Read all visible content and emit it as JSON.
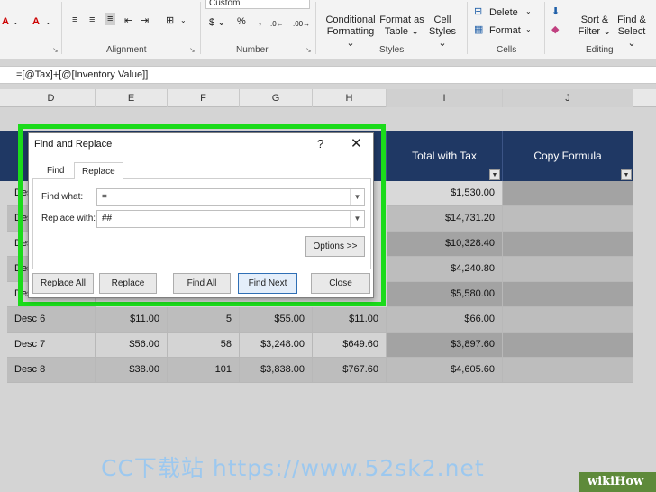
{
  "ribbon": {
    "number_format": "Custom",
    "groups": {
      "alignment": "Alignment",
      "number": "Number",
      "styles": "Styles",
      "cells": "Cells",
      "editing": "Editing"
    },
    "buttons": {
      "conditional_formatting": "Conditional\nFormatting ⌄",
      "format_as_table": "Format as\nTable ⌄",
      "cell_styles": "Cell\nStyles ⌄",
      "delete": "Delete",
      "format": "Format",
      "sort_filter": "Sort &\nFilter ⌄",
      "find_select": "Find &\nSelect ⌄"
    }
  },
  "formula_bar": {
    "formula": "=[@Tax]+[@[Inventory Value]]"
  },
  "columns": [
    "D",
    "E",
    "F",
    "G",
    "H",
    "I",
    "J"
  ],
  "table": {
    "headers": {
      "total_with_tax": "Total with Tax",
      "copy_formula": "Copy Formula"
    },
    "rows_partial": [
      {
        "d": "Desc",
        "i": "$1,530.00"
      },
      {
        "d": "Desc",
        "i": "$14,731.20"
      },
      {
        "d": "Desc",
        "i": "$10,328.40"
      },
      {
        "d": "Desc",
        "i": "$4,240.80"
      },
      {
        "d": "Desc",
        "i": "$5,580.00"
      }
    ],
    "rows": [
      {
        "d": "Desc 6",
        "e": "$11.00",
        "f": "5",
        "g": "$55.00",
        "h": "$11.00",
        "i": "$66.00"
      },
      {
        "d": "Desc 7",
        "e": "$56.00",
        "f": "58",
        "g": "$3,248.00",
        "h": "$649.60",
        "i": "$3,897.60"
      },
      {
        "d": "Desc 8",
        "e": "$38.00",
        "f": "101",
        "g": "$3,838.00",
        "h": "$767.60",
        "i": "$4,605.60"
      }
    ]
  },
  "dialog": {
    "title": "Find and Replace",
    "help": "?",
    "close": "✕",
    "tabs": [
      "Find",
      "Replace"
    ],
    "find_label": "Find what:",
    "find_value": "=",
    "replace_label": "Replace with:",
    "replace_value": "##",
    "options": "Options >>",
    "buttons": [
      "Replace All",
      "Replace",
      "Find All",
      "Find Next",
      "Close"
    ]
  },
  "watermark": "CC下载站 https://www.52sk2.net",
  "brand": "wikiHow",
  "colors": {
    "table_header": "#1f3864",
    "highlight": "#1bdb1b",
    "selected_cells": "#bfbfbf"
  }
}
